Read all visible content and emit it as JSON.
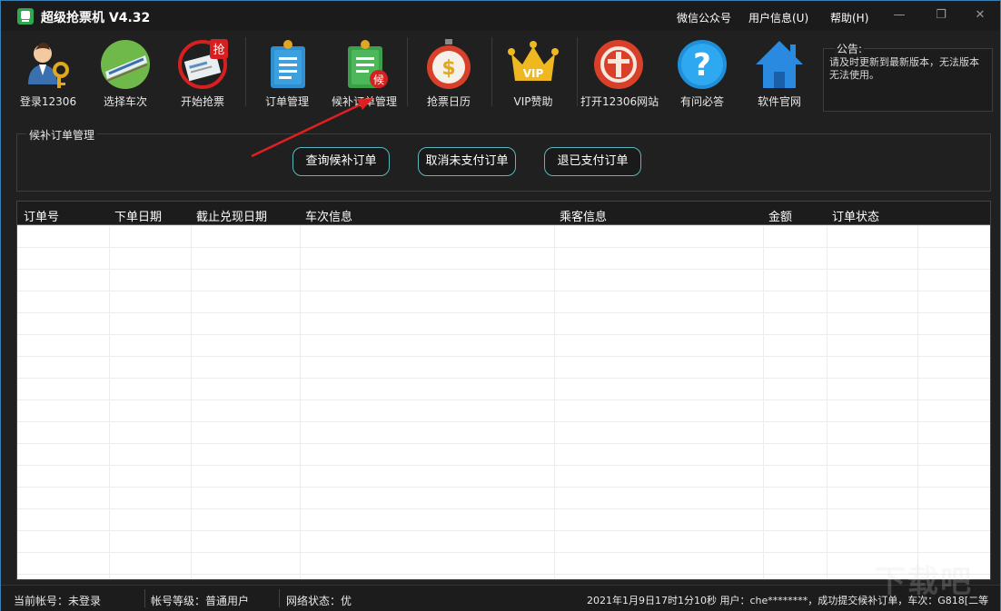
{
  "window": {
    "title": "超级抢票机 V4.32",
    "menus": [
      "微信公众号",
      "用户信息(U)",
      "帮助(H)"
    ]
  },
  "toolbar": {
    "items": [
      {
        "label": "登录12306",
        "icon": "login-user-key-icon"
      },
      {
        "label": "选择车次",
        "icon": "train-icon"
      },
      {
        "label": "开始抢票",
        "icon": "grab-ticket-icon",
        "badge": "抢"
      },
      {
        "label": "订单管理",
        "icon": "order-document-icon"
      },
      {
        "label": "候补订单管理",
        "icon": "waitlist-document-icon",
        "badge": "候"
      },
      {
        "label": "抢票日历",
        "icon": "stopwatch-dollar-icon"
      },
      {
        "label": "VIP赞助",
        "icon": "vip-crown-icon",
        "badge": "VIP"
      },
      {
        "label": "打开12306网站",
        "icon": "railway-logo-icon"
      },
      {
        "label": "有问必答",
        "icon": "question-icon"
      },
      {
        "label": "软件官网",
        "icon": "home-icon"
      }
    ]
  },
  "notice": {
    "title": "公告:",
    "text": "请及时更新到最新版本，无法版本无法使用。"
  },
  "waitlist": {
    "title": "候补订单管理",
    "buttons": [
      "查询候补订单",
      "取消未支付订单",
      "退已支付订单"
    ]
  },
  "table": {
    "columns": [
      "订单号",
      "下单日期",
      "截止兑现日期",
      "车次信息",
      "乘客信息",
      "金额",
      "订单状态"
    ],
    "rows": []
  },
  "status": {
    "account": "当前帐号：未登录",
    "level": "帐号等级：普通用户",
    "network": "网络状态：优",
    "log": "2021年1月9日17时1分10秒 用户：che********，成功提交候补订单，车次：G818[二等"
  },
  "watermark": "下载吧",
  "colors": {
    "accent_border": "#57b7bf",
    "arrow": "#e02020",
    "window_border": "#3c7fb1"
  }
}
